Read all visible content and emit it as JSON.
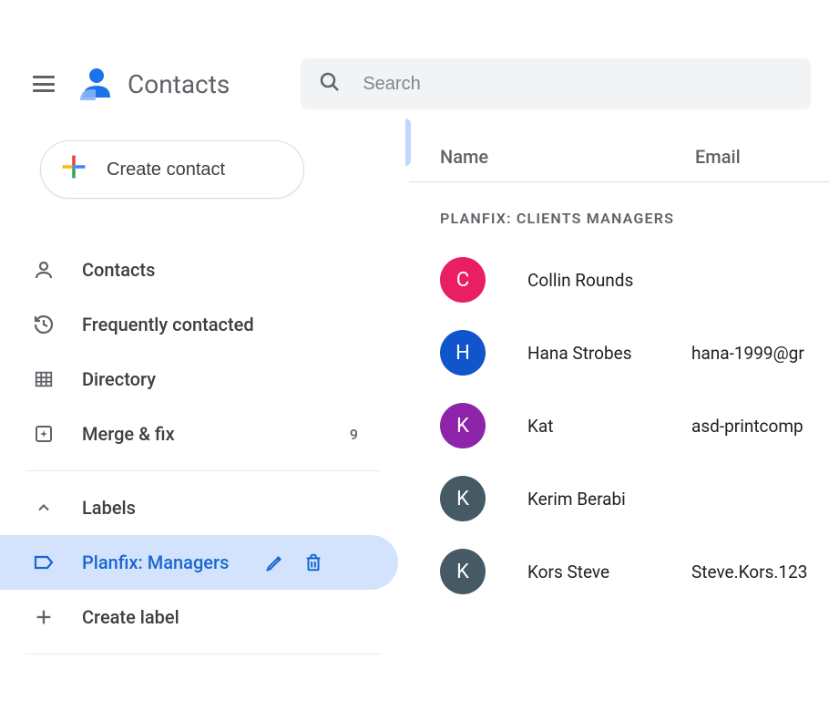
{
  "header": {
    "app_title": "Contacts",
    "search_placeholder": "Search"
  },
  "sidebar": {
    "create_label": "Create contact",
    "nav": [
      {
        "label": "Contacts"
      },
      {
        "label": "Frequently contacted"
      },
      {
        "label": "Directory"
      },
      {
        "label": "Merge & fix",
        "badge": "9"
      }
    ],
    "labels_header": "Labels",
    "labels": [
      {
        "label": "Planfix: Managers",
        "selected": true
      }
    ],
    "create_label_label": "Create label"
  },
  "main": {
    "columns": {
      "name": "Name",
      "email": "Email"
    },
    "section_title": "PLANFIX: CLIENTS MANAGERS",
    "contacts": [
      {
        "initial": "C",
        "color": "#e91e63",
        "name": "Collin Rounds",
        "email": ""
      },
      {
        "initial": "H",
        "color": "#1155cc",
        "name": "Hana Strobes",
        "email": "hana-1999@gr"
      },
      {
        "initial": "K",
        "color": "#8e24aa",
        "name": "Kat",
        "email": "asd-printcomp"
      },
      {
        "initial": "K",
        "color": "#455a64",
        "name": "Kerim Berabi",
        "email": ""
      },
      {
        "initial": "K",
        "color": "#455a64",
        "name": "Kors Steve",
        "email": "Steve.Kors.123"
      }
    ]
  }
}
